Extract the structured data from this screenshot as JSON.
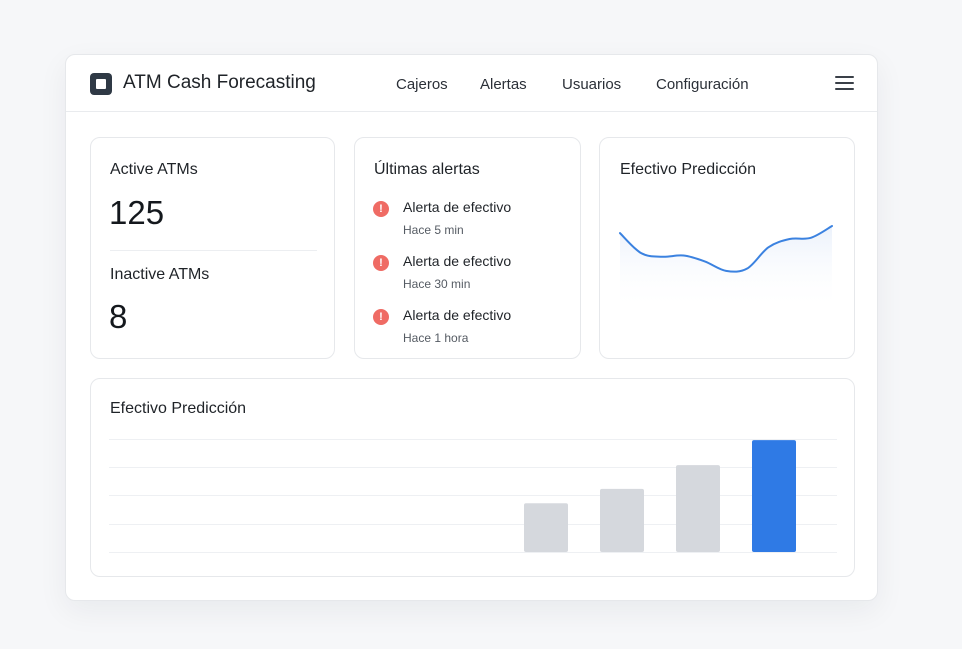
{
  "header": {
    "app_title": "ATM Cash Forecasting",
    "nav": [
      "Cajeros",
      "Alertas",
      "Usuarios",
      "Configuración"
    ],
    "menu_icon": "hamburger-menu-icon"
  },
  "stats": {
    "active_label": "Active ATMs",
    "active_value": "125",
    "inactive_label": "Inactive ATMs",
    "inactive_value": "8"
  },
  "alerts": {
    "title": "Últimas alertas",
    "icon": "alert-circle-icon",
    "icon_color": "#ef6b64",
    "items": [
      {
        "title": "Alerta de efectivo",
        "time": "Hace 5 min"
      },
      {
        "title": "Alerta de efectivo",
        "time": "Hace 30 min"
      },
      {
        "title": "Alerta de efectivo",
        "time": "Hace 1 hora"
      }
    ]
  },
  "line_card": {
    "title": "Efectivo Predicción"
  },
  "bar_card": {
    "title": "Efectivo Predicción"
  },
  "colors": {
    "accent": "#2f7ae5",
    "bar_muted": "#d5d8dd",
    "line": "#3b82e0"
  },
  "chart_data": [
    {
      "type": "line",
      "title": "Efectivo Predicción",
      "x": [
        0,
        1,
        2,
        3,
        4,
        5,
        6,
        7,
        8,
        9,
        10
      ],
      "values": [
        66,
        49,
        46,
        47,
        42,
        34,
        36,
        54,
        61,
        62,
        72
      ],
      "ylim": [
        0,
        100
      ],
      "grid": false,
      "area_fill": true
    },
    {
      "type": "bar",
      "title": "Efectivo Predicción",
      "categories": [
        "",
        "",
        "",
        ""
      ],
      "values": [
        41,
        53,
        73,
        94
      ],
      "ylim": [
        0,
        100
      ],
      "grid": true,
      "highlight_index": 3
    }
  ]
}
